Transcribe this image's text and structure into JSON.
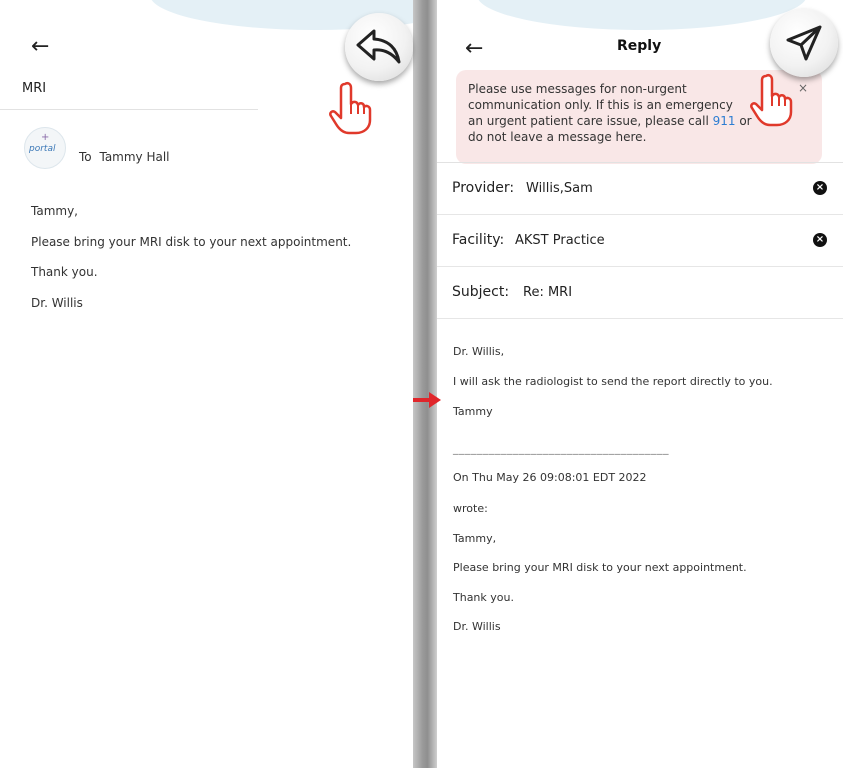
{
  "left": {
    "subject": "MRI",
    "to_prefix": "To",
    "to_name": "Tammy Hall",
    "logo_text": "portal",
    "message_lines": [
      "Tammy,",
      "Please bring your MRI disk to your next appointment.",
      "Thank you.",
      "Dr. Willis"
    ]
  },
  "right": {
    "title": "Reply",
    "urgent_notice": {
      "line1": "Please use messages for non-urgent",
      "line2": "communication only. If this is an emergency",
      "line3_a": "an urgent patient care issue, please call ",
      "line3_phone": "911",
      "line3_b": " or",
      "line4": "do not leave a message here.",
      "close_glyph": "×"
    },
    "provider": {
      "label": "Provider:",
      "value": "Willis,Sam"
    },
    "facility": {
      "label": "Facility:",
      "value": "AKST Practice"
    },
    "subject": {
      "label": "Subject:",
      "value": "Re: MRI"
    },
    "body_lines": [
      "Dr. Willis,",
      "I will ask the radiologist to send the report directly to you.",
      "Tammy"
    ],
    "separator": "____________________________________",
    "quote_header": "On Thu May 26 09:08:01 EDT 2022",
    "quote_wrote": "wrote:",
    "quoted_lines": [
      "Tammy,",
      "Please bring your MRI disk to your next appointment.",
      "Thank you.",
      "Dr. Willis"
    ]
  },
  "icons": {
    "back": "back-arrow-icon",
    "reply": "reply-arrow-icon",
    "send": "send-paper-plane-icon",
    "hand": "pointing-hand-icon",
    "clear": "clear-x-icon",
    "transition": "red-right-arrow-icon"
  },
  "colors": {
    "accent_hand": "#e0392b",
    "arrow_red": "#e0262b",
    "link_blue": "#2d7dd2",
    "notice_bg": "#f9e7e7"
  }
}
